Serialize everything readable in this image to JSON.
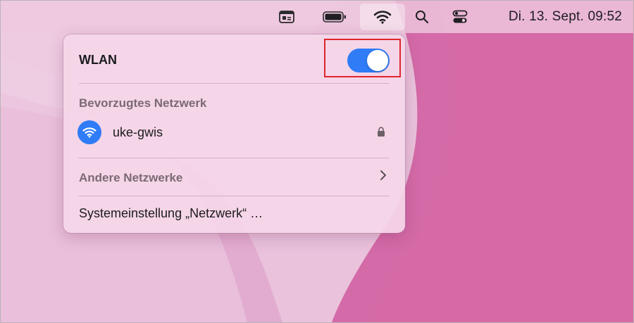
{
  "menubar": {
    "icons": [
      "input-source-icon",
      "battery-icon",
      "wifi-icon",
      "search-icon",
      "control-center-icon"
    ],
    "clock": "Di. 13. Sept. 09:52"
  },
  "wlan_panel": {
    "title": "WLAN",
    "toggle_on": true,
    "preferred_label": "Bevorzugtes Netzwerk",
    "network": {
      "name": "uke-gwis",
      "icon": "wifi-icon",
      "secured": true
    },
    "other_networks_label": "Andere Netzwerke",
    "settings_label": "Systemeinstellung „Netzwerk“ …"
  },
  "colors": {
    "accent": "#2f7cf6",
    "annotation_box": "#e0262c"
  }
}
